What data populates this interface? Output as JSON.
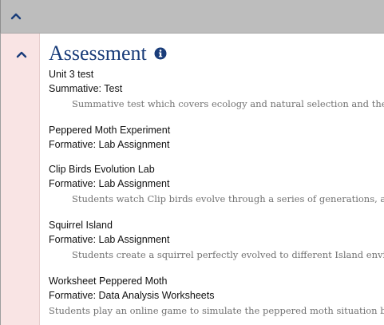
{
  "section": {
    "title": "Assessment",
    "colors": {
      "title": "#1a3d7a",
      "left_strip": "#f9e4e4",
      "top_bar": "#bdbdbd"
    },
    "icons": {
      "top_toggle": "chevron-up-icon",
      "section_toggle": "chevron-up-icon",
      "info": "info-circle-icon"
    }
  },
  "items": [
    {
      "name": "Unit 3 test",
      "type": "Summative: Test",
      "description": "Summative test which covers ecology and natural selection and the V"
    },
    {
      "name": "Peppered Moth Experiment",
      "type": "Formative: Lab Assignment",
      "description": ""
    },
    {
      "name": "Clip Birds Evolution Lab",
      "type": "Formative: Lab Assignment",
      "description": "Students watch Clip birds evolve through a series of generations, and"
    },
    {
      "name": "Squirrel Island",
      "type": "Formative: Lab Assignment",
      "description": "Students create a squirrel perfectly evolved to different Island enviror"
    },
    {
      "name": "Worksheet Peppered Moth",
      "type": "Formative: Data Analysis Worksheets",
      "description": "Students play an online game to simulate the peppered moth situation bef"
    }
  ]
}
